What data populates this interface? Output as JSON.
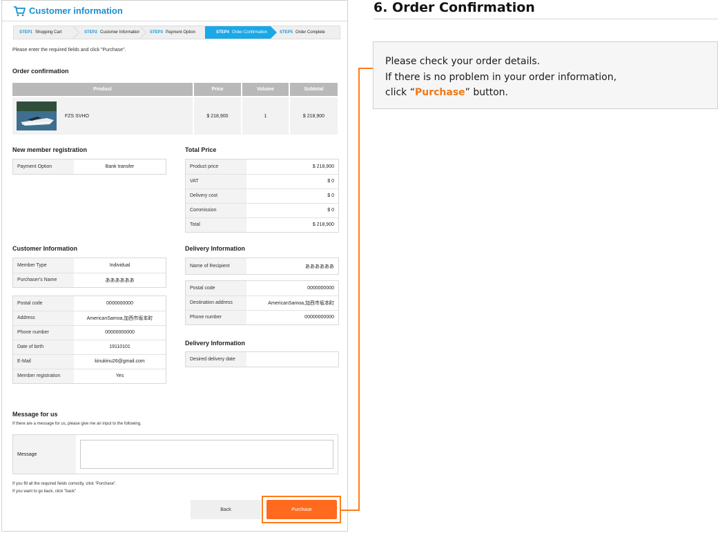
{
  "panel": {
    "title": "Customer information",
    "intro": "Please enter the required fields and click \"Purchase\"."
  },
  "steps": [
    {
      "num": "STEP1",
      "label": "Shopping Cart"
    },
    {
      "num": "STEP2",
      "label": "Customer Information"
    },
    {
      "num": "STEP3",
      "label": "Payment Option"
    },
    {
      "num": "STEP4",
      "label": "Order Confirmation"
    },
    {
      "num": "STEP5",
      "label": "Order Complete"
    }
  ],
  "active_step": 4,
  "order": {
    "title": "Order confirmation",
    "headers": [
      "Product",
      "Price",
      "Volume",
      "Subtotal"
    ],
    "rows": [
      {
        "product": "FZS SVHO",
        "price": "$ 218,900",
        "volume": "1",
        "subtotal": "$ 218,900"
      }
    ]
  },
  "member": {
    "title": "New member registration",
    "rows": [
      {
        "k": "Payment Option",
        "v": "Bank transfer"
      }
    ]
  },
  "total": {
    "title": "Total Price",
    "rows": [
      {
        "k": "Product price",
        "v": "$ 218,900"
      },
      {
        "k": "VAT",
        "v": "$ 0"
      },
      {
        "k": "Delivery cost",
        "v": "$ 0"
      },
      {
        "k": "Commission",
        "v": "$ 0"
      },
      {
        "k": "Total",
        "v": "$ 218,900"
      }
    ]
  },
  "customer": {
    "title": "Customer Information",
    "rows_a": [
      {
        "k": "Member Type",
        "v": "Individual"
      },
      {
        "k": "Purchaser's Name",
        "v": "ああああああ"
      }
    ],
    "rows_b": [
      {
        "k": "Postal code",
        "v": "0000000000"
      },
      {
        "k": "Address",
        "v": "AmericanSamoa,加西市坂本町"
      },
      {
        "k": "Phone number",
        "v": "00000000000"
      },
      {
        "k": "Date of birth",
        "v": "19110101"
      },
      {
        "k": "E-Mail",
        "v": "kinukinu26@gmail.com"
      },
      {
        "k": "Member registration",
        "v": "Yes"
      }
    ]
  },
  "delivery": {
    "title": "Delivery Information",
    "rows_a": [
      {
        "k": "Name of Recipient",
        "v": "ああああああ"
      }
    ],
    "rows_b": [
      {
        "k": "Postal code",
        "v": "0000000000"
      },
      {
        "k": "Destination address",
        "v": "AmericanSamoa,加西市坂本町"
      },
      {
        "k": "Phone number",
        "v": "00000000000"
      }
    ]
  },
  "delivery2": {
    "title": "Delivery Information",
    "rows": [
      {
        "k": "Desired delivery date",
        "v": ""
      }
    ]
  },
  "message": {
    "title": "Message for us",
    "note": "If there are a message for us, please give me an input to the following.",
    "label": "Message",
    "value": ""
  },
  "footer": {
    "note1": "If you fill all the required fields correctly, click \"Purchase\".",
    "note2": "If you want to go back, click \"back\""
  },
  "buttons": {
    "back": "Back",
    "purchase": "Purchase"
  },
  "right": {
    "title": "6. Order Confirmation",
    "line1": "Please check your order details.",
    "line2": "If there is no problem in your order information,",
    "line3_pre": "click “",
    "line3_em": "Purchase",
    "line3_post": "” button."
  },
  "colors": {
    "accent": "#1a8fd1",
    "step_active": "#1aa8e6",
    "purchase": "#ff6a1f",
    "highlight": "#ff7a1a"
  }
}
